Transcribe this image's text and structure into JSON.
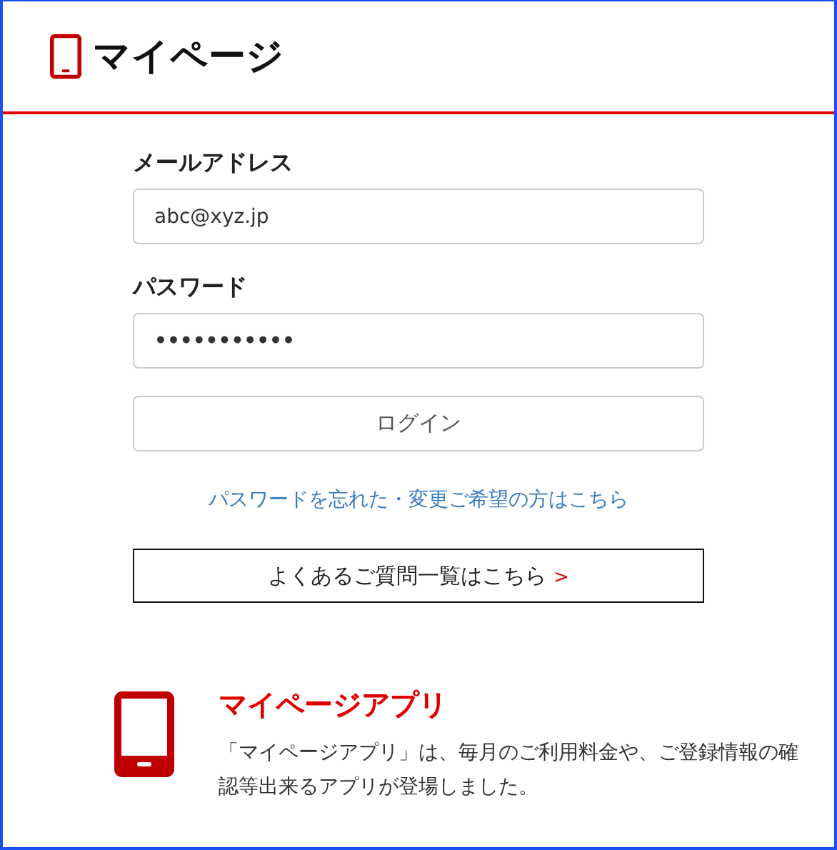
{
  "header": {
    "title": "マイページ"
  },
  "form": {
    "email_label": "メールアドレス",
    "email_value": "abc@xyz.jp",
    "password_label": "パスワード",
    "password_value": "•••••••••••",
    "login_button": "ログイン",
    "forgot_link": "パスワードを忘れた・変更ご希望の方はこちら",
    "faq_button": "よくあるご質問一覧はこちら",
    "faq_arrow": ">"
  },
  "app_promo": {
    "title": "マイページアプリ",
    "description": "「マイページアプリ」は、毎月のご利用料金や、ご登録情報の確認等出来るアプリが登場しました。"
  }
}
